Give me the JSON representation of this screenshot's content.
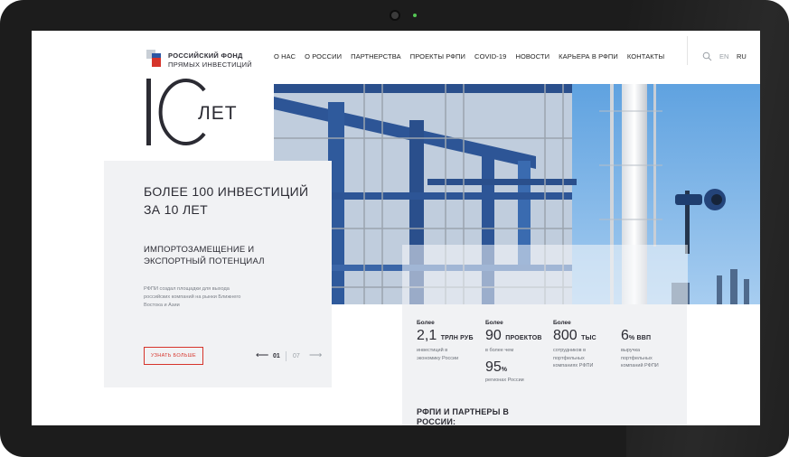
{
  "header": {
    "logo_line1": "РОССИЙСКИЙ ФОНД",
    "logo_line2": "ПРЯМЫХ ИНВЕСТИЦИЙ",
    "nav": [
      "О НАС",
      "О РОССИИ",
      "ПАРТНЕРСТВА",
      "ПРОЕКТЫ РФПИ",
      "COVID-19",
      "НОВОСТИ",
      "КАРЬЕРА В РФПИ",
      "КОНТАКТЫ"
    ],
    "lang_en": "EN",
    "lang_ru": "RU"
  },
  "jubilee": {
    "number": "10",
    "word": "ЛЕТ"
  },
  "slide": {
    "title": "БОЛЕЕ 100 ИНВЕСТИЦИЙ ЗА 10 ЛЕТ",
    "subtitle": "ИМПОРТОЗАМЕЩЕНИЕ И ЭКСПОРТНЫЙ ПОТЕНЦИАЛ",
    "description": "РФПИ создал площадки для выхода российских компаний на рынки Ближнего Востока и Азии",
    "button_label": "УЗНАТЬ БОЛЬШЕ",
    "current": "01",
    "total": "07"
  },
  "stats": [
    {
      "label": "Более",
      "value": "2,1",
      "unit": "ТРЛН РУБ",
      "desc": "инвестиций в экономику России"
    },
    {
      "label": "Более",
      "value": "90",
      "unit": "ПРОЕКТОВ",
      "desc": "в более чем"
    },
    {
      "label": "",
      "value": "95",
      "unit": "%",
      "desc": "регионах России"
    },
    {
      "label": "Более",
      "value": "800",
      "unit": "ТЫС",
      "desc": "сотрудников в портфельных компаниях РФПИ"
    },
    {
      "label": "",
      "value": "6",
      "unit": "% ВВП",
      "desc": "выручка портфельных компаний РФПИ"
    }
  ],
  "partners_title": "РФПИ И ПАРТНЕРЫ В РОССИИ:",
  "colors": {
    "accent": "#d6342b",
    "brand_blue": "#2c56a3",
    "text_dark": "#2b2b33",
    "panel_bg": "#f1f2f4"
  }
}
